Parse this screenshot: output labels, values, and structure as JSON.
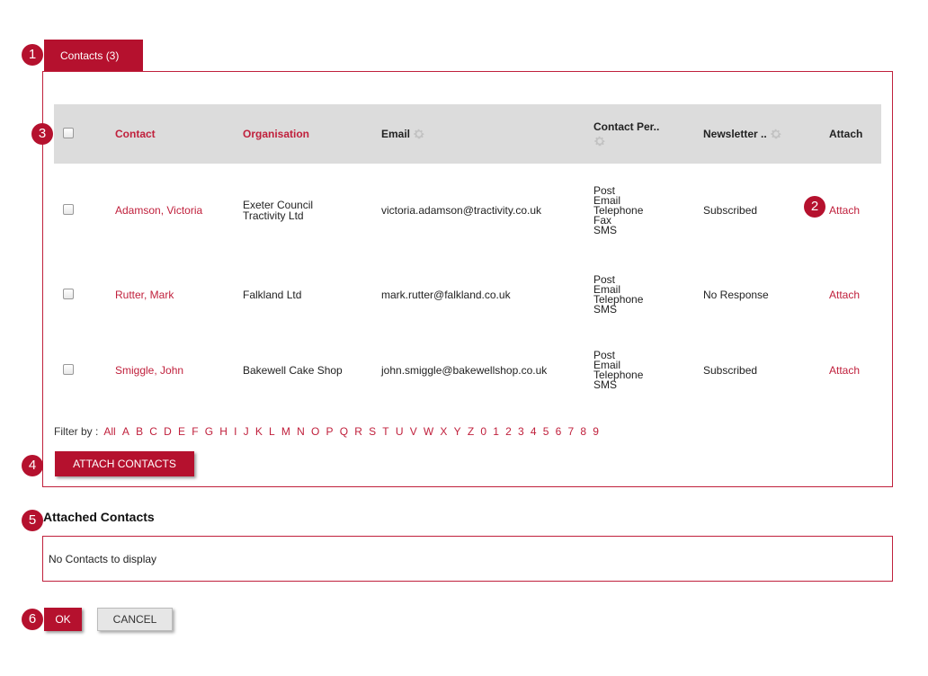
{
  "tab": {
    "label": "Contacts (3)"
  },
  "badges": [
    "1",
    "2",
    "3",
    "4",
    "5",
    "6"
  ],
  "table": {
    "headers": {
      "contact": "Contact",
      "organisation": "Organisation",
      "email": "Email",
      "contact_pref": "Contact Per..",
      "newsletter": "Newsletter ..",
      "attach": "Attach"
    },
    "rows": [
      {
        "contact": "Adamson, Victoria",
        "organisation": [
          "Exeter Council",
          "Tractivity Ltd"
        ],
        "email": "victoria.adamson@tractivity.co.uk",
        "methods": [
          "Post",
          "Email",
          "Telephone",
          "Fax",
          "SMS"
        ],
        "newsletter": "Subscribed",
        "attach": "Attach"
      },
      {
        "contact": "Rutter, Mark",
        "organisation": [
          "Falkland Ltd"
        ],
        "email": "mark.rutter@falkland.co.uk",
        "methods": [
          "Post",
          "Email",
          "Telephone",
          "SMS"
        ],
        "newsletter": "No Response",
        "attach": "Attach"
      },
      {
        "contact": "Smiggle, John",
        "organisation": [
          "Bakewell Cake Shop"
        ],
        "email": "john.smiggle@bakewellshop.co.uk",
        "methods": [
          "Post",
          "Email",
          "Telephone",
          "SMS"
        ],
        "newsletter": "Subscribed",
        "attach": "Attach"
      }
    ]
  },
  "filter": {
    "label": "Filter by :",
    "options": [
      "All",
      "A",
      "B",
      "C",
      "D",
      "E",
      "F",
      "G",
      "H",
      "I",
      "J",
      "K",
      "L",
      "M",
      "N",
      "O",
      "P",
      "Q",
      "R",
      "S",
      "T",
      "U",
      "V",
      "W",
      "X",
      "Y",
      "Z",
      "0",
      "1",
      "2",
      "3",
      "4",
      "5",
      "6",
      "7",
      "8",
      "9"
    ]
  },
  "attach_button": "ATTACH CONTACTS",
  "attached": {
    "title": "Attached Contacts",
    "empty_message": "No Contacts to display"
  },
  "buttons": {
    "ok": "OK",
    "cancel": "CANCEL"
  },
  "colors": {
    "accent": "#b5112e",
    "header_bg": "#dcdcdc"
  },
  "icons": {
    "column_settings": "gear-icon"
  }
}
